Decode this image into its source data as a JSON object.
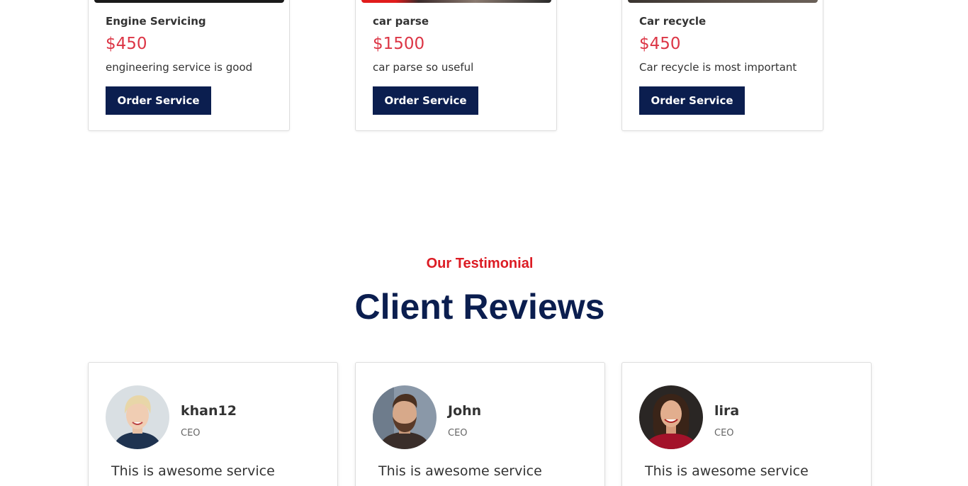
{
  "services": [
    {
      "title": "Engine Servicing",
      "price": "$450",
      "description": "engineering service is good",
      "button_label": "Order Service",
      "image_color": "#1a1a1a"
    },
    {
      "title": "car parse",
      "price": "$1500",
      "description": "car parse so useful",
      "button_label": "Order Service",
      "image_color": "#e11b1b"
    },
    {
      "title": "Car recycle",
      "price": "$450",
      "description": "Car recycle is most important",
      "button_label": "Order Service",
      "image_color": "#5a5048"
    }
  ],
  "testimonial": {
    "eyebrow": "Our Testimonial",
    "title": "Client Reviews"
  },
  "reviews": [
    {
      "name": "khan12",
      "role": "CEO",
      "text": "This is awesome service",
      "avatar_icon": "avatar-woman-short-hair"
    },
    {
      "name": "John",
      "role": "CEO",
      "text": "This is awesome service",
      "avatar_icon": "avatar-man-beard"
    },
    {
      "name": "lira",
      "role": "CEO",
      "text": "This is awesome service",
      "avatar_icon": "avatar-woman-red-top"
    }
  ],
  "colors": {
    "accent_red": "#dc1c24",
    "price_red": "#dc3545",
    "navy": "#0b1e4f"
  }
}
